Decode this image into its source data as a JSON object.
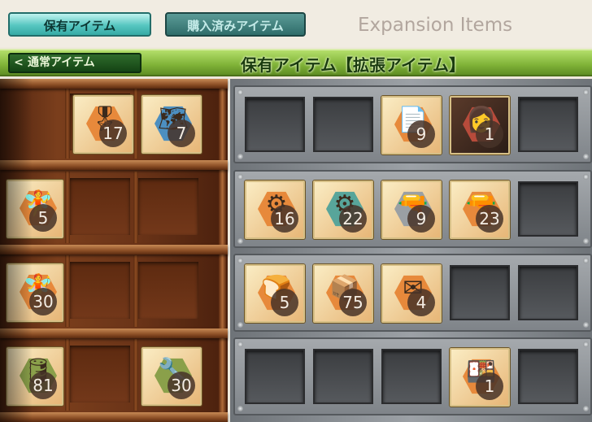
{
  "tabs": {
    "owned": "保有アイテム",
    "purchased": "購入済みアイテム",
    "heading": "Expansion Items"
  },
  "banner": {
    "back_label": "通常アイテム",
    "back_chevron": "<",
    "title": "保有アイテム【拡張アイテム】"
  },
  "wood_items": [
    {
      "icon": "medal-icon",
      "glyph": "🎖",
      "count": "17"
    },
    {
      "icon": "blueprint-icon",
      "glyph": "🗺",
      "count": "7"
    },
    {
      "icon": "fairy-icon",
      "glyph": "🧚",
      "count": "5"
    },
    {
      "icon": "fairy-hat-icon",
      "glyph": "🧚",
      "count": "30"
    },
    {
      "icon": "drum-canister-icon",
      "glyph": "🛢",
      "count": "81"
    },
    {
      "icon": "tools-icon",
      "glyph": "🔧",
      "count": "30"
    }
  ],
  "metal_items": [
    {
      "icon": "documents-icon",
      "glyph": "📄",
      "count": "9"
    },
    {
      "icon": "pilot-icon",
      "glyph": "👩",
      "count": "1"
    },
    {
      "icon": "turret-icon",
      "glyph": "⚙",
      "count": "16"
    },
    {
      "icon": "turbine-icon",
      "glyph": "⚙",
      "count": "22"
    },
    {
      "icon": "mortar-icon",
      "glyph": "🔫",
      "count": "9"
    },
    {
      "icon": "gun-fairy-icon",
      "glyph": "🔫",
      "count": "23"
    },
    {
      "icon": "bread-icon",
      "glyph": "🍞",
      "count": "5"
    },
    {
      "icon": "crate-icon",
      "glyph": "📦",
      "count": "75"
    },
    {
      "icon": "letters-icon",
      "glyph": "✉",
      "count": "4"
    },
    {
      "icon": "feast-icon",
      "glyph": "🍱",
      "count": "1"
    }
  ]
}
